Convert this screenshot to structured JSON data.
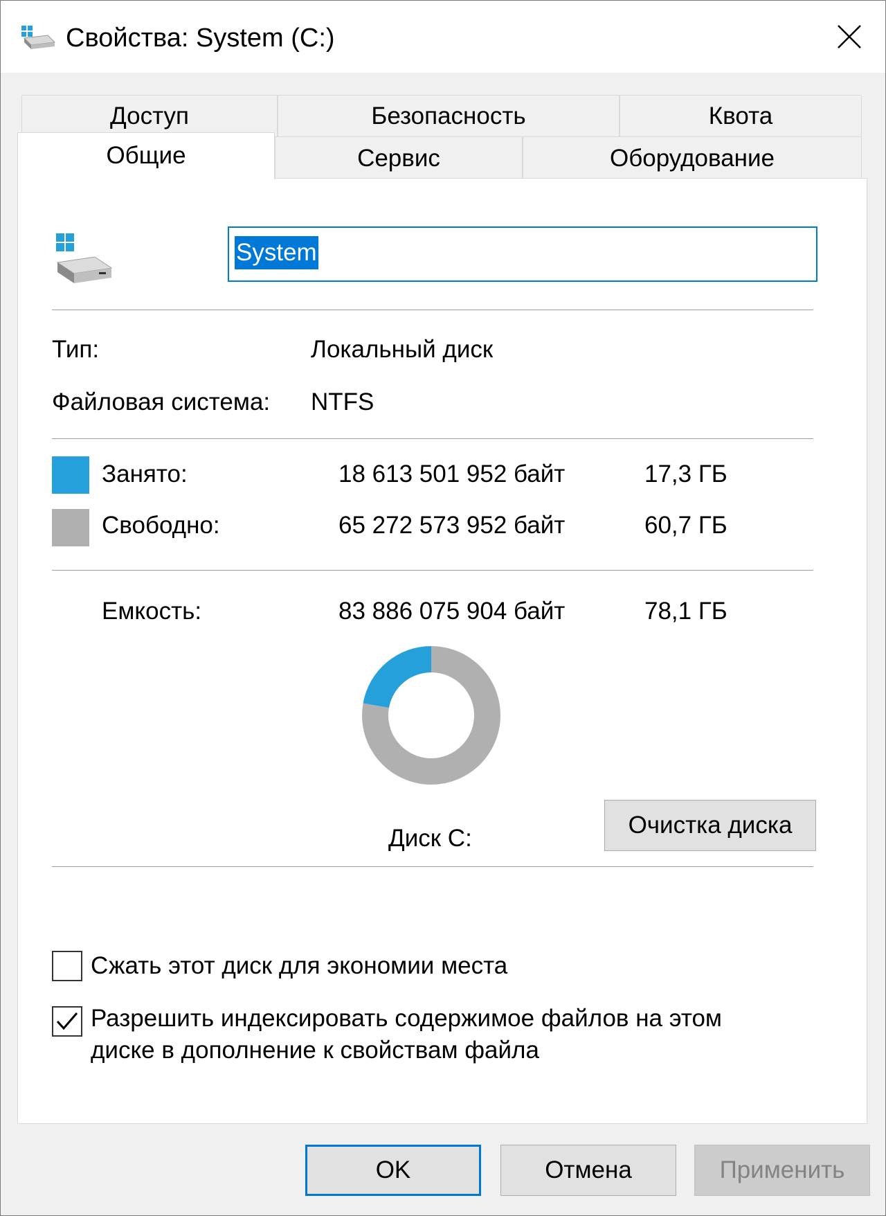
{
  "window": {
    "title": "Свойства: System (C:)"
  },
  "tabs": {
    "row1": [
      "Доступ",
      "Безопасность",
      "Квота"
    ],
    "row2": [
      "Общие",
      "Сервис",
      "Оборудование"
    ],
    "active": "Общие"
  },
  "general": {
    "volume_name": "System",
    "type_label": "Тип:",
    "type_value": "Локальный диск",
    "fs_label": "Файловая система:",
    "fs_value": "NTFS",
    "used": {
      "label": "Занято:",
      "bytes": "18 613 501 952 байт",
      "size": "17,3 ГБ",
      "color": "#26a0da"
    },
    "free": {
      "label": "Свободно:",
      "bytes": "65 272 573 952 байт",
      "size": "60,7 ГБ",
      "color": "#b0b0b0"
    },
    "capacity": {
      "label": "Емкость:",
      "bytes": "83 886 075 904 байт",
      "size": "78,1 ГБ"
    },
    "used_fraction": 0.222,
    "drive_label": "Диск C:",
    "cleanup_button": "Очистка диска",
    "compress_label": "Сжать этот диск для экономии места",
    "compress_checked": false,
    "index_label_line1": "Разрешить индексировать содержимое файлов на этом",
    "index_label_line2": "диске в дополнение к свойствам файла",
    "index_checked": true
  },
  "buttons": {
    "ok": "OK",
    "cancel": "Отмена",
    "apply": "Применить"
  },
  "colors": {
    "accent": "#0078d7",
    "window_bg": "#f0f0f0",
    "panel_bg": "#ffffff"
  }
}
